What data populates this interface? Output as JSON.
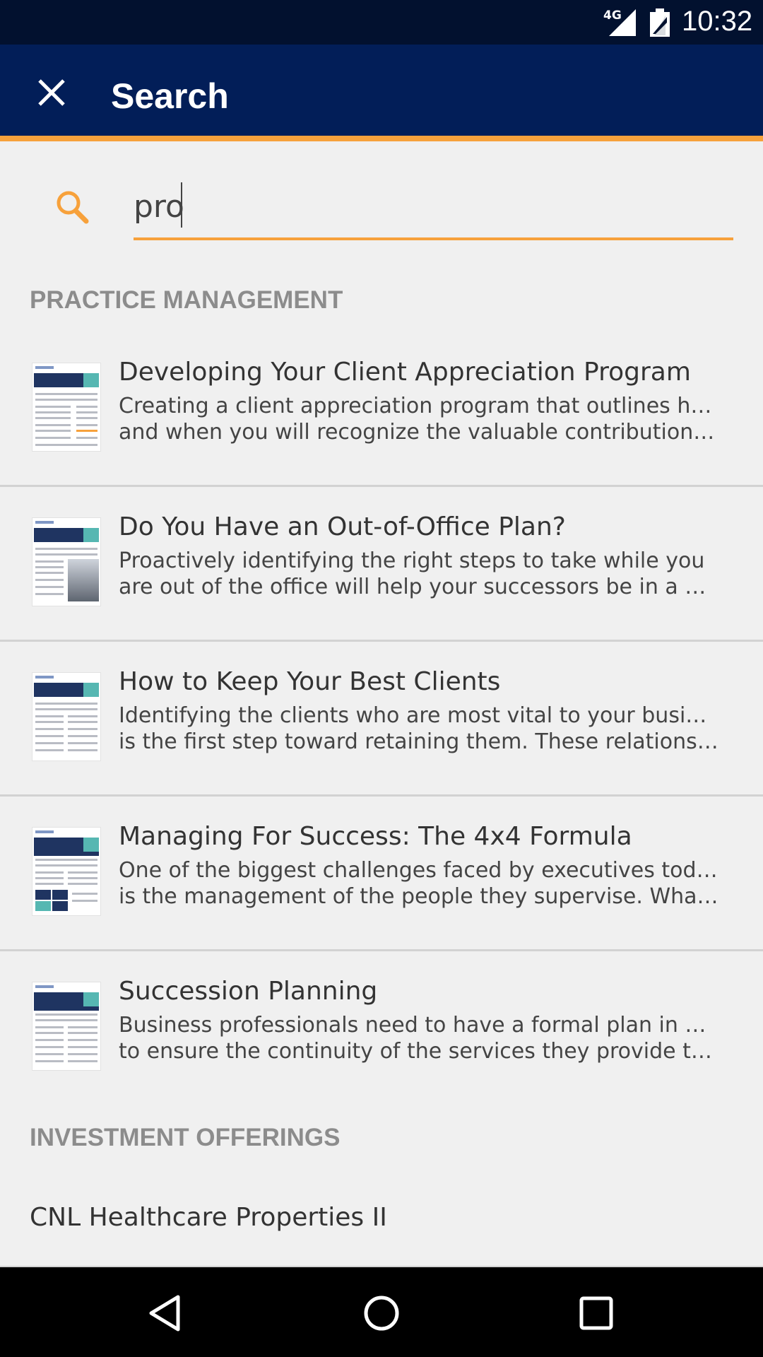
{
  "status_bar": {
    "network": "4G",
    "time": "10:32"
  },
  "app_bar": {
    "title": "Search"
  },
  "search": {
    "value": "pro"
  },
  "sections": [
    {
      "header": "PRACTICE MANAGEMENT",
      "items": [
        {
          "title": "Developing Your Client Appreciation Program",
          "desc_line1": "Creating a client appreciation program that outlines how",
          "desc_line2": "and when you will recognize the valuable contributions yo…"
        },
        {
          "title": "Do You Have an Out-of-Office Plan?",
          "desc_line1": "Proactively identifying the right steps to take while you",
          "desc_line2": "are out of the office will help your successors be in a bett…"
        },
        {
          "title": "How to Keep Your Best Clients",
          "desc_line1": "Identifying the clients who are most vital to your business",
          "desc_line2": "is the first step toward retaining them.  These relationship…"
        },
        {
          "title": "Managing For Success: The 4x4 Formula",
          "desc_line1": "One of the biggest challenges faced by executives today",
          "desc_line2": "is the management of the people they supervise. What foll…"
        },
        {
          "title": "Succession Planning",
          "desc_line1": "Business professionals need to have a formal plan in place",
          "desc_line2": "to ensure the continuity of the services they provide to the…"
        }
      ]
    },
    {
      "header": "INVESTMENT OFFERINGS",
      "items": [
        {
          "title": "CNL Healthcare Properties II"
        }
      ]
    }
  ],
  "icons": {
    "close": "close-icon",
    "search": "search-icon",
    "back": "back-icon",
    "home": "home-icon",
    "recents": "recents-icon"
  },
  "colors": {
    "status_bar": "#02112f",
    "app_bar": "#021e58",
    "accent": "#f7a13b",
    "section_header": "#8c8c8c",
    "background": "#f0f0f0"
  }
}
